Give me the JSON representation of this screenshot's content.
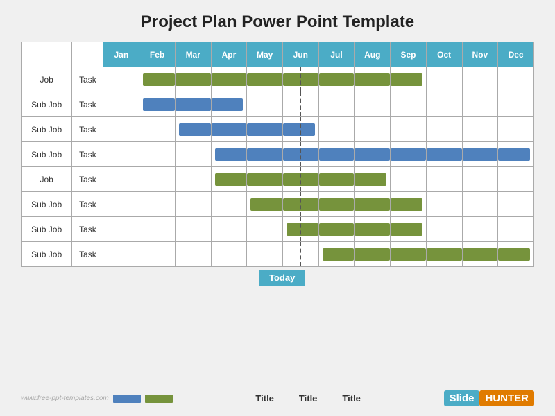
{
  "title": "Project Plan Power Point Template",
  "months": [
    "Jan",
    "Feb",
    "Mar",
    "Apr",
    "May",
    "Jun",
    "Jul",
    "Aug",
    "Sep",
    "Oct",
    "Nov",
    "Dec"
  ],
  "rows": [
    {
      "label": "Job",
      "task": "Task",
      "bars": [
        {
          "start": 1,
          "span": 8,
          "type": "green"
        }
      ]
    },
    {
      "label": "Sub Job",
      "task": "Task",
      "bars": [
        {
          "start": 1,
          "span": 3,
          "type": "blue"
        }
      ]
    },
    {
      "label": "Sub Job",
      "task": "Task",
      "bars": [
        {
          "start": 2,
          "span": 4,
          "type": "blue"
        }
      ]
    },
    {
      "label": "Sub Job",
      "task": "Task",
      "bars": [
        {
          "start": 3,
          "span": 9,
          "type": "blue"
        }
      ]
    },
    {
      "label": "Job",
      "task": "Task",
      "bars": [
        {
          "start": 3,
          "span": 5,
          "type": "green"
        }
      ]
    },
    {
      "label": "Sub Job",
      "task": "Task",
      "bars": [
        {
          "start": 4,
          "span": 5,
          "type": "green"
        }
      ]
    },
    {
      "label": "Sub Job",
      "task": "Task",
      "bars": [
        {
          "start": 5,
          "span": 4,
          "type": "green"
        }
      ]
    },
    {
      "label": "Sub Job",
      "task": "Task",
      "bars": [
        {
          "start": 6,
          "span": 6,
          "type": "green"
        }
      ]
    }
  ],
  "today_label": "Today",
  "today_col": 5,
  "legend": {
    "site": "www.free-ppt-templates.com",
    "blue_label": "",
    "green_label": ""
  },
  "footer": {
    "titles": [
      "Title",
      "Title",
      "Title"
    ],
    "logo_slide": "Slide",
    "logo_hunter": "HUNTER"
  }
}
